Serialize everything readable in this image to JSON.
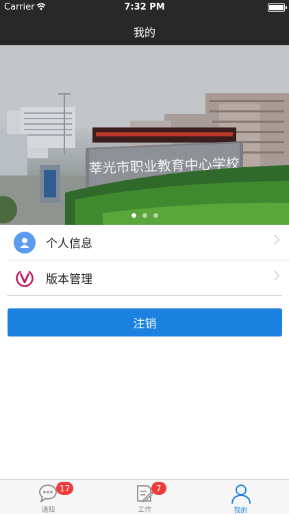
{
  "status_bar": {
    "carrier": "Carrier",
    "time": "7:32 PM"
  },
  "nav": {
    "title": "我的"
  },
  "banner": {
    "slide_count": 3,
    "active_index": 0,
    "signboard_text": "莘光市职业教育中心学校"
  },
  "list": {
    "items": [
      {
        "label": "个人信息",
        "icon": "person-icon",
        "icon_color": "#5b9bf0"
      },
      {
        "label": "版本管理",
        "icon": "version-v-icon",
        "icon_color": "#c2185b"
      }
    ]
  },
  "logout": {
    "label": "注销"
  },
  "tabs": [
    {
      "label": "通知",
      "icon": "chat-bubble-icon",
      "badge": "17",
      "active": false
    },
    {
      "label": "工作",
      "icon": "document-edit-icon",
      "badge": "7",
      "active": false
    },
    {
      "label": "我的",
      "icon": "user-outline-icon",
      "badge": "",
      "active": true
    }
  ],
  "colors": {
    "accent": "#1b82e0",
    "badge": "#f03a3a",
    "header_bg": "#282828"
  }
}
